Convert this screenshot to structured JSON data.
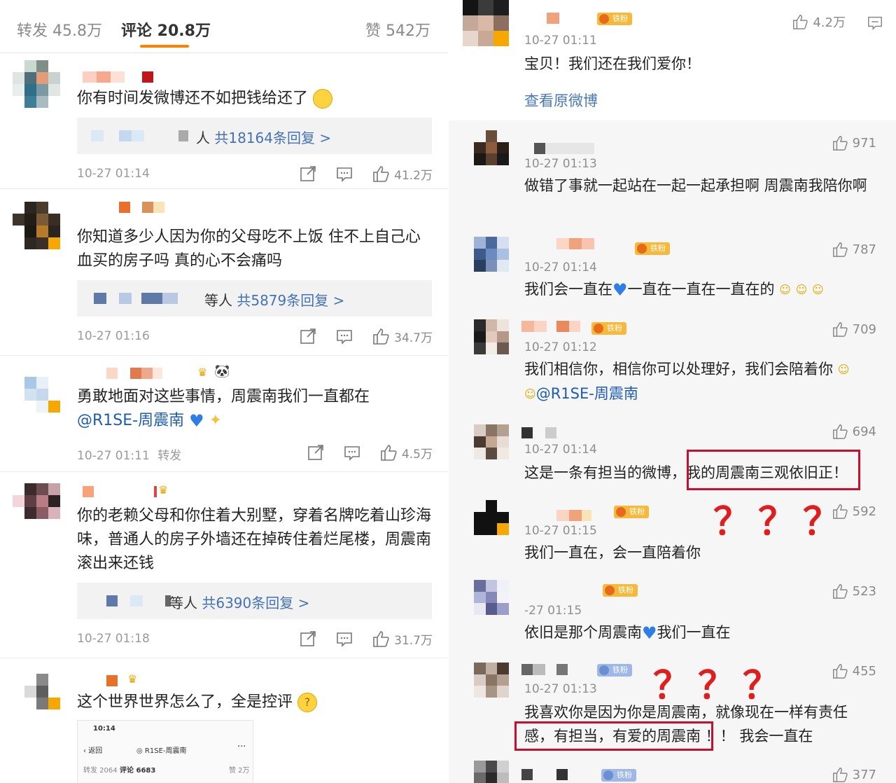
{
  "left": {
    "tabs": {
      "repost": "转发 45.8万",
      "comments": "评论 20.8万",
      "likes": "赞 542万"
    },
    "comments": [
      {
        "text": "你有时间发微博还不如把钱给还了",
        "reply_prefix": "人",
        "reply_link": "共18164条回复 >",
        "time": "10-27 01:14",
        "likes": "41.2万"
      },
      {
        "text": "你知道多少人因为你的父母吃不上饭 住不上自己心血买的房子吗 真的心不会痛吗",
        "reply_prefix": "等人",
        "reply_link": "共5879条回复 >",
        "time": "10-27 01:16",
        "likes": "34.7万"
      },
      {
        "text": "勇敢地面对这些事情，周震南我们一直都在",
        "mention": "@R1SE-周震南",
        "time": "10-27 01:11",
        "repost_label": "转发",
        "likes": "4.5万"
      },
      {
        "text": "你的老赖父母和你住着大别墅，穿着名牌吃着山珍海味，普通人的房子外墙还在掉砖住着烂尾楼，周震南滚出来还钱",
        "reply_prefix": "等人",
        "reply_link": "共6390条回复 >",
        "time": "10-27 01:18",
        "likes": "31.7万"
      },
      {
        "text": "这个世界世界怎么了，全是控评"
      }
    ],
    "mini_screenshot": {
      "clock": "10:14",
      "back": "返回",
      "account": "R1SE-周震南",
      "repost": "转发 2064",
      "comments": "评论 6683",
      "likes": "赞 2万",
      "more": "···"
    }
  },
  "right": {
    "top_comment": {
      "badge": "铁粉",
      "time": "10-27 01:11",
      "text": "宝贝！我们还在我们爱你！",
      "likes": "4.2万",
      "view_original": "查看原微博"
    },
    "replies": [
      {
        "time": "10-27 01:13",
        "text": "做错了事就一起站在一起一起承担啊 周震南我陪你啊",
        "likes": "971"
      },
      {
        "badge": "铁粉",
        "time": "10-27 01:14",
        "text": "我们会一直在",
        "text2": "一直在一直在一直在的",
        "likes": "787"
      },
      {
        "badge": "铁粉",
        "time": "10-27 01:12",
        "text": "我们相信你，相信你可以处理好，我们会陪着你",
        "mention": "@R1SE-周震南",
        "likes": "709"
      },
      {
        "time": "10-27 01:14",
        "text_a": "这是一条有担当的微博，",
        "text_b": "我的周震南三观依旧正！",
        "likes": "694"
      },
      {
        "badge": "铁粉",
        "time": "10-27 01:15",
        "text": "我们一直在，会一直陪着你",
        "likes": "592"
      },
      {
        "badge": "铁粉",
        "time": "-27 01:15",
        "text": "依旧是那个周震南",
        "text2": "我们一直在",
        "likes": "523"
      },
      {
        "badge": "铁粉",
        "time": "10-27 01:13",
        "text_a": "我喜欢你是因为你是周震南，就像现在一样有责任",
        "text_b": "感，有担当，有爱的周震南",
        "text_c": " ！！ 我会一直在",
        "likes": "455"
      },
      {
        "badge": "铁粉",
        "likes": "377"
      }
    ],
    "question_mark": "？"
  },
  "colors": {
    "accent": "#ff8200",
    "link": "#4472b8",
    "highlight": "#c8102e"
  }
}
